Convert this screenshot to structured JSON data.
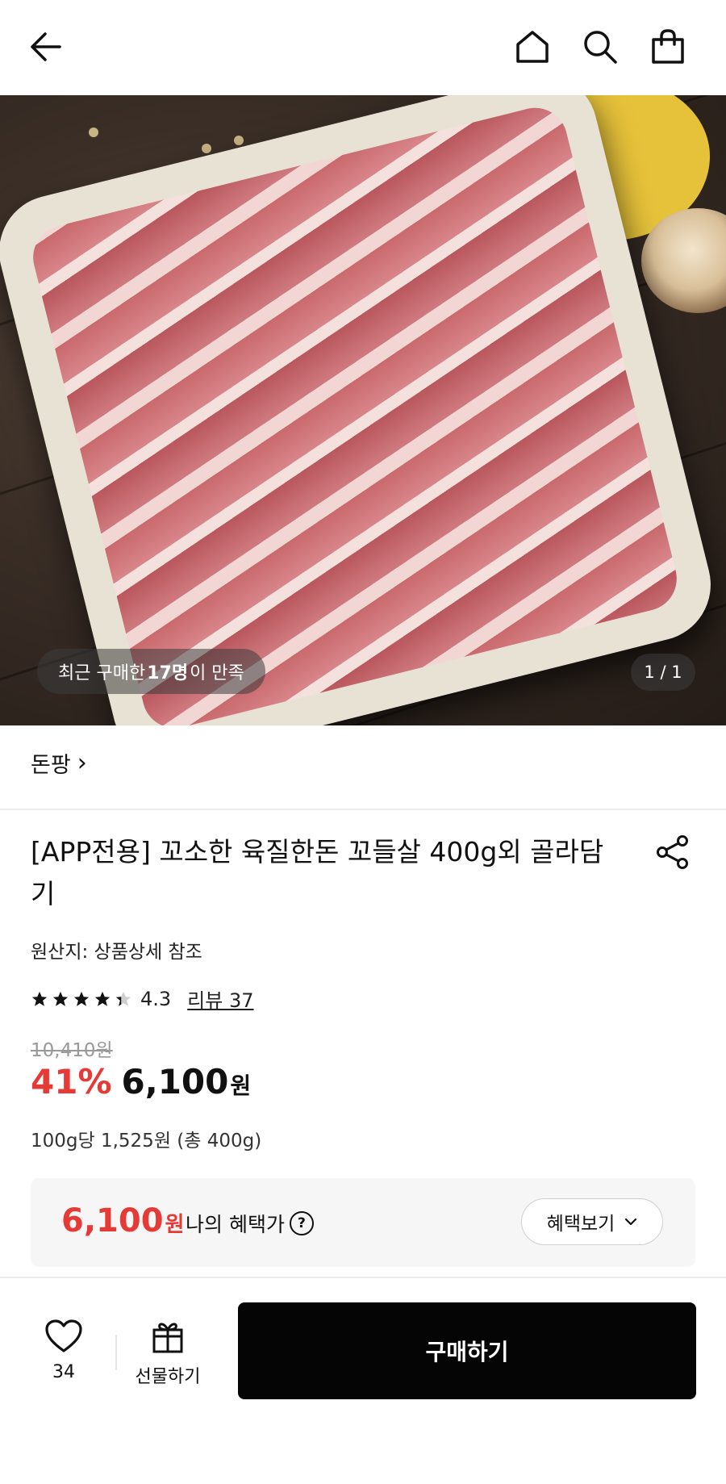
{
  "header": {
    "back_icon": "arrow-left-icon",
    "home_icon": "home-icon",
    "search_icon": "search-icon",
    "cart_icon": "shopping-bag-icon"
  },
  "gallery": {
    "badge": {
      "prefix": "최근 구매한 ",
      "highlight": "17명",
      "suffix": "이 만족"
    },
    "pager": "1 / 1"
  },
  "brand": {
    "name": "돈팡",
    "chevron": "›"
  },
  "product": {
    "title": "[APP전용] 꼬소한 육질한돈 꼬들살 400g외 골라담기",
    "origin": "원산지: 상품상세 참조",
    "rating": 4.3,
    "rating_text": "4.3",
    "review_label": "리뷰 37",
    "original_price": "10,410원",
    "discount": "41%",
    "price": "6,100",
    "currency": "원",
    "unit_price": "100g당 1,525원 (총 400g)"
  },
  "benefit": {
    "price": "6,100",
    "currency": "원",
    "label": "나의 혜택가",
    "help": "?",
    "button": "혜택보기"
  },
  "bottom": {
    "like_count": "34",
    "gift_label": "선물하기",
    "buy_label": "구매하기"
  },
  "colors": {
    "accent_red": "#e53a35",
    "buy_button": "#050505",
    "benefit_bg": "#f6f6f6"
  }
}
